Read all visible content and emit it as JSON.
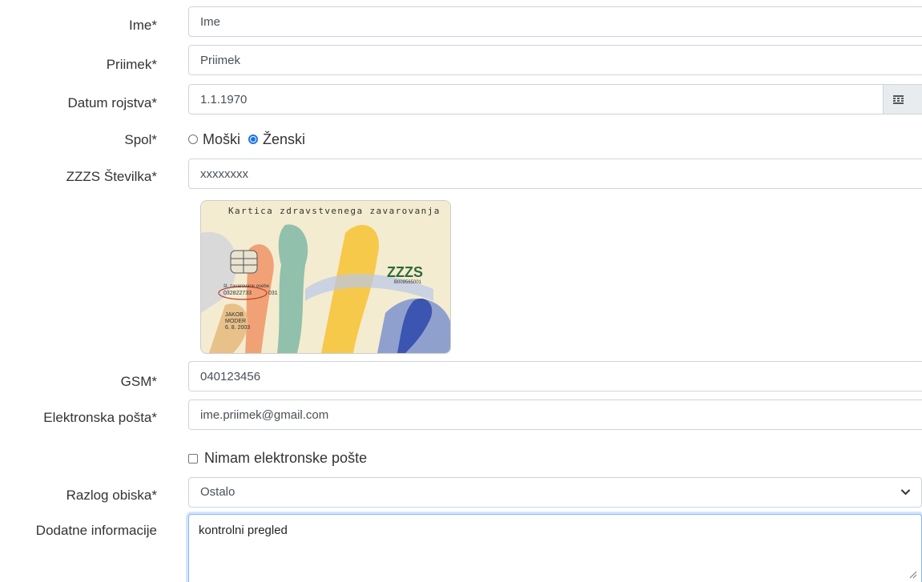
{
  "form": {
    "first_name": {
      "label": "Ime*",
      "value": "Ime"
    },
    "last_name": {
      "label": "Priimek*",
      "value": "Priimek"
    },
    "birth_date": {
      "label": "Datum rojstva*",
      "value": "1.1.1970",
      "icon": "calendar-icon"
    },
    "gender": {
      "label": "Spol*",
      "options": [
        {
          "label": "Moški",
          "checked": false
        },
        {
          "label": "Ženski",
          "checked": true
        }
      ]
    },
    "zzzs_number": {
      "label": "ZZZS Številka*",
      "value": "xxxxxxxx"
    },
    "card": {
      "title": "Kartica zdravstvenega zavarovanja",
      "logo": "ZZZS",
      "logo_number": "B009565001",
      "person_label": "št. zavarovane osebe",
      "person_number": "032822733",
      "person_suffix": "031",
      "holder_first": "JAKOB",
      "holder_last": "MODER",
      "holder_date": "6. 8. 2003"
    },
    "phone": {
      "label": "GSM*",
      "value": "040123456"
    },
    "email": {
      "label": "Elektronska pošta*",
      "value": "ime.priimek@gmail.com"
    },
    "no_email": {
      "label": "Nimam elektronske pošte",
      "checked": false
    },
    "visit_reason": {
      "label": "Razlog obiska*",
      "value": "Ostalo"
    },
    "additional_info": {
      "label": "Dodatne informacije",
      "value": "kontrolni pregled"
    }
  },
  "colors": {
    "border": "#ced4da",
    "focus_border": "#86b7fe",
    "radio_checked": "#1a73e8",
    "addon_bg": "#e9ecef"
  }
}
